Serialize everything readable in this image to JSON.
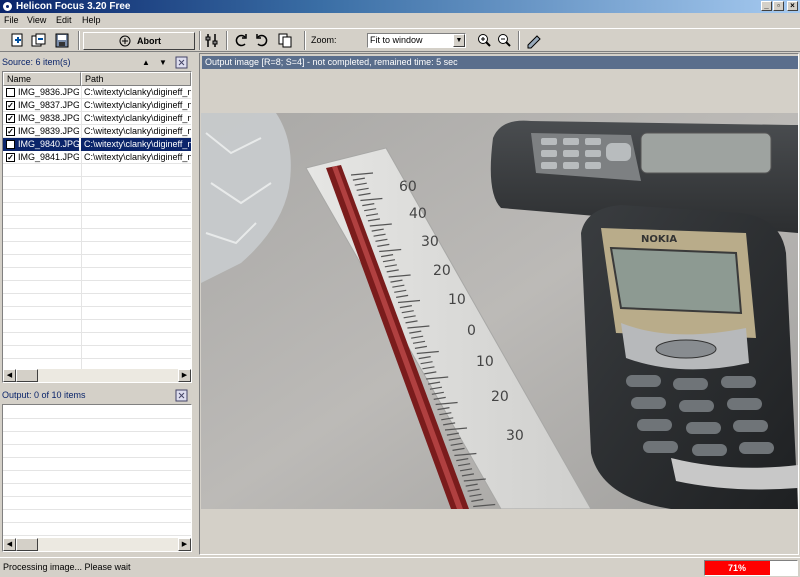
{
  "window": {
    "title": "Helicon Focus 3.20 Free",
    "controls": [
      "_",
      "▫",
      "×"
    ]
  },
  "menu": [
    "File",
    "View",
    "Edit",
    "Help"
  ],
  "toolbar": {
    "abort_label": "Abort",
    "zoom_label": "Zoom:",
    "zoom_value": "Fit to window"
  },
  "source": {
    "header": "Source: 6 item(s)",
    "columns": [
      "Name",
      "Path"
    ],
    "items": [
      {
        "name": "IMG_9836.JPG",
        "path": "C:\\witexty\\clanky\\digineff_ne",
        "checked": false,
        "selected": false
      },
      {
        "name": "IMG_9837.JPG",
        "path": "C:\\witexty\\clanky\\digineff_ne",
        "checked": true,
        "selected": false
      },
      {
        "name": "IMG_9838.JPG",
        "path": "C:\\witexty\\clanky\\digineff_ne",
        "checked": true,
        "selected": false
      },
      {
        "name": "IMG_9839.JPG",
        "path": "C:\\witexty\\clanky\\digineff_ne",
        "checked": true,
        "selected": false
      },
      {
        "name": "IMG_9840.JPG",
        "path": "C:\\witexty\\clanky\\digineff_ne",
        "checked": true,
        "selected": true
      },
      {
        "name": "IMG_9841.JPG",
        "path": "C:\\witexty\\clanky\\digineff_ne",
        "checked": true,
        "selected": false
      }
    ]
  },
  "output": {
    "header": "Output: 0 of 10 items"
  },
  "image": {
    "caption": "Output image [R=8; S=4] - not completed, remained time: 5 sec",
    "thermometer_labels": [
      "60",
      "40",
      "30",
      "20",
      "10",
      "0",
      "10",
      "20",
      "30"
    ],
    "phone_brand": "NOKIA"
  },
  "status": {
    "text": "Processing image... Please wait",
    "progress_label": "71%",
    "progress_value": 0.71
  },
  "colors": {
    "progress": "#ff0000",
    "selection": "#0a246a",
    "titlebar": "#0a246a"
  }
}
